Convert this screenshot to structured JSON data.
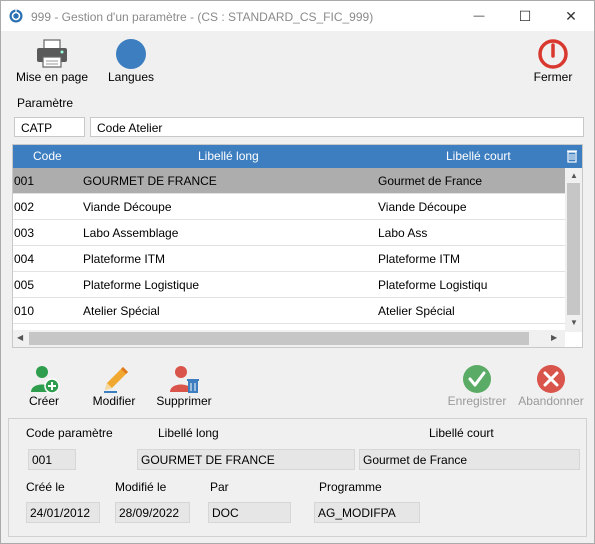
{
  "window": {
    "title": "999 - Gestion d'un paramètre - (CS : STANDARD_CS_FIC_999)",
    "controls": {
      "minimize": "—",
      "maximize": "☐",
      "close": "✕"
    }
  },
  "toolbar": {
    "print_label": "Mise en page",
    "languages_label": "Langues",
    "close_label": "Fermer"
  },
  "parameter": {
    "section_label": "Paramètre",
    "code": "CATP",
    "label": "Code Atelier"
  },
  "grid": {
    "columns": [
      "Code",
      "Libellé long",
      "Libellé court"
    ],
    "rows": [
      {
        "code": "001",
        "long": "GOURMET DE FRANCE",
        "short": "Gourmet de France",
        "selected": true
      },
      {
        "code": "002",
        "long": "Viande Découpe",
        "short": "Viande Découpe",
        "selected": false
      },
      {
        "code": "003",
        "long": "Labo Assemblage",
        "short": "Labo Ass",
        "selected": false
      },
      {
        "code": "004",
        "long": "Plateforme ITM",
        "short": "Plateforme ITM",
        "selected": false
      },
      {
        "code": "005",
        "long": "Plateforme Logistique",
        "short": "Plateforme Logistiqu",
        "selected": false
      },
      {
        "code": "010",
        "long": "Atelier Spécial",
        "short": "Atelier Spécial",
        "selected": false
      }
    ]
  },
  "actions": {
    "create_label": "Créer",
    "modify_label": "Modifier",
    "delete_label": "Supprimer",
    "save_label": "Enregistrer",
    "cancel_label": "Abandonner"
  },
  "detail": {
    "code_label": "Code paramètre",
    "long_label": "Libellé long",
    "short_label": "Libellé court",
    "code_value": "001",
    "long_value": "GOURMET DE FRANCE",
    "short_value": "Gourmet de France",
    "created_label": "Créé le",
    "modified_label": "Modifié le",
    "by_label": "Par",
    "program_label": "Programme",
    "created_value": "24/01/2012",
    "modified_value": "28/09/2022",
    "by_value": "DOC",
    "program_value": "AG_MODIFPA"
  },
  "colors": {
    "header_blue": "#3c7ec0",
    "selected_row": "#adadad",
    "close_red": "#d9382f",
    "create_green": "#2e9d4e",
    "save_green": "#5aab66",
    "cancel_red": "#d9544a"
  }
}
